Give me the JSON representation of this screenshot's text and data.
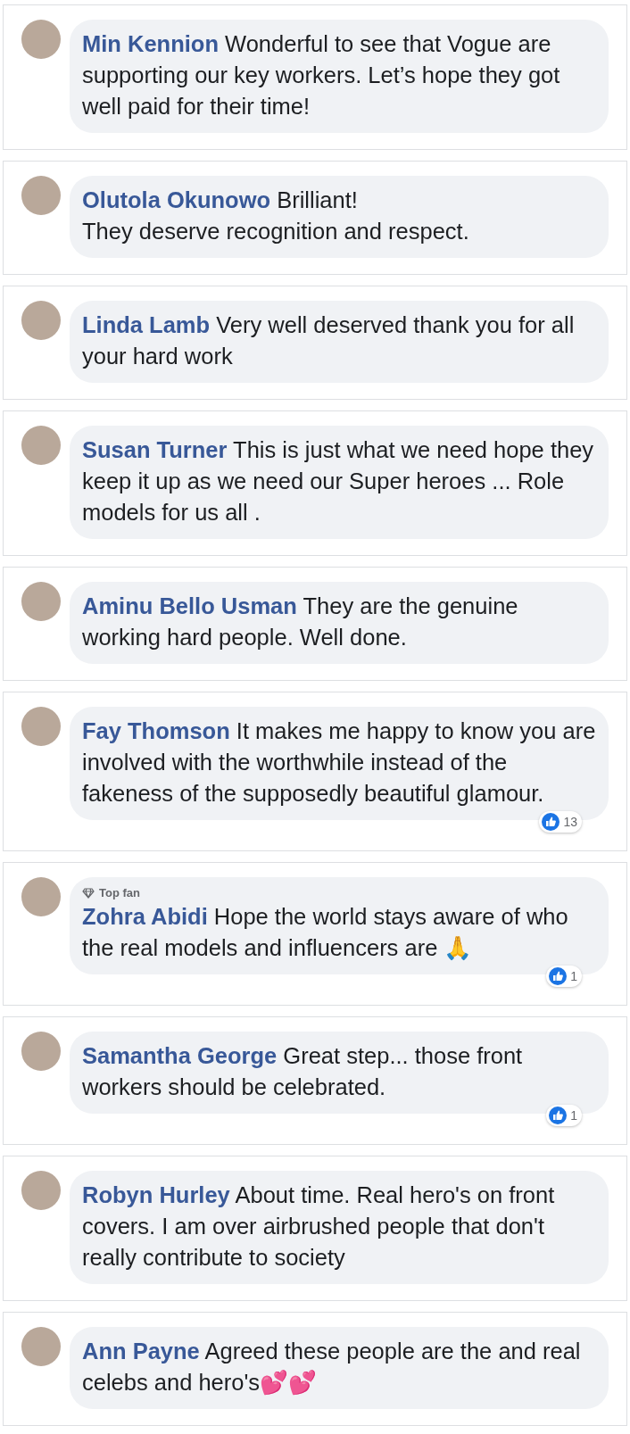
{
  "comments": [
    {
      "name": "Min Kennion",
      "text": "Wonderful to see that Vogue are supporting our key workers. Let’s hope they got well paid for their time!"
    },
    {
      "name": "Olutola Okunowo",
      "text": "Brilliant!\nThey deserve recognition and respect."
    },
    {
      "name": "Linda Lamb",
      "text": "Very well deserved thank you for all your hard work"
    },
    {
      "name": "Susan Turner",
      "text": "This is just what we need hope they keep it up as we need our Super heroes ... Role models for us all ."
    },
    {
      "name": "Aminu Bello Usman",
      "text": "They are the genuine working hard people. Well done."
    },
    {
      "name": "Fay Thomson",
      "text": "It makes me happy to know you are involved with the worthwhile instead of the fakeness of the supposedly beautiful glamour.",
      "reactions": "13"
    },
    {
      "name": "Zohra Abidi",
      "badge": "Top fan",
      "text": "Hope the world stays aware of who the real models and influencers are 🙏",
      "reactions": "1"
    },
    {
      "name": "Samantha George",
      "text": "Great step... those front workers should be celebrated.",
      "reactions": "1"
    },
    {
      "name": "Robyn Hurley",
      "text": "About time. Real hero's on front covers. I am over airbrushed people that don't really contribute to society"
    },
    {
      "name": "Ann Payne",
      "text": "Agreed these people are the and real celebs and hero's💕💕"
    }
  ]
}
